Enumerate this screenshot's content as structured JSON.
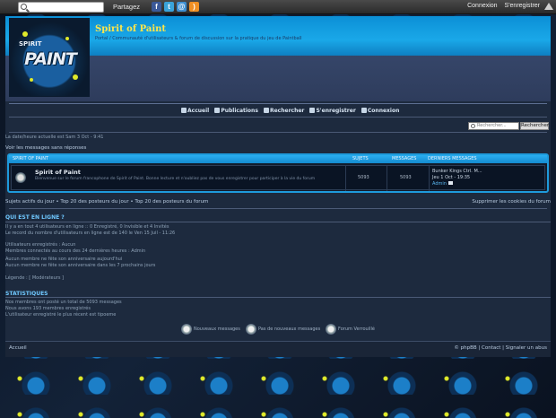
{
  "topbar": {
    "partagez": "Partagez",
    "connexion": "Connexion",
    "register": "S'enregistrer"
  },
  "header": {
    "logo_text": "PAINT",
    "logo_small": "SPIRIT",
    "title": "Spirit of Paint",
    "description": "Portal / Communauté d'utilisateurs & forum de discussion sur la pratique du jeu de Paintball"
  },
  "nav": {
    "items": [
      "Accueil",
      "Publications",
      "Rechercher",
      "S'enregistrer",
      "Connexion"
    ]
  },
  "search": {
    "placeholder": "Rechercher...",
    "button": "Rechercher"
  },
  "date_line": "La date/heure actuelle est Sam 3 Oct - 9:41",
  "unanswered_link": "Voir les messages sans réponses",
  "forum": {
    "category": "SPIRIT OF PAINT",
    "col_topics": "SUJETS",
    "col_posts": "MESSAGES",
    "col_last": "DERNIERS MESSAGES",
    "name": "Spirit of Paint",
    "description": "Bienvenue sur le forum francophone de Spirit of Paint. Bonne lecture et n'oubliez pas de vous enregistrer pour participer à la vie du forum",
    "topics": "5093",
    "posts": "5093",
    "last_title": "Bunker Kings Ctrl. M...",
    "last_date": "Jeu 1 Oct - 19:35",
    "last_author": "Admin"
  },
  "bottom_links": {
    "left": "Sujets actifs du jour • Top 20 des posteurs du jour • Top 20 des posteurs du forum",
    "right": "Supprimer les cookies du forum"
  },
  "online": {
    "title": "QUI EST EN LIGNE ?",
    "line1": "Il y a en tout 4 utilisateurs en ligne :: 0 Enregistré, 0 Invisible et 4 Invités",
    "line2": "Le record du nombre d'utilisateurs en ligne est de 140 le Ven 15 Juil - 11:26",
    "line3": "Utilisateurs enregistrés : Aucun",
    "line4": "Membres connectés au cours des 24 dernières heures : Admin",
    "line5": "Aucun membre ne fête son anniversaire aujourd'hui",
    "line6": "Aucun membre ne fête son anniversaire dans les 7 prochains jours",
    "legend": "Légende : [ Modérateurs ]"
  },
  "stats": {
    "title": "STATISTIQUES",
    "line1": "Nos membres ont posté un total de 5093 messages",
    "line2": "Nous avons 193 membres enregistrés",
    "line3": "L'utilisateur enregistré le plus récent est tipoeme"
  },
  "legend_icons": {
    "new": "Nouveaux messages",
    "none": "Pas de nouveaux messages",
    "locked": "Forum Verrouillé"
  },
  "footer": {
    "left": "Accueil",
    "right": "© phpBB | Contact | Signaler un abus"
  },
  "colors": {
    "accent": "#1e9bdc",
    "title_yellow": "#ffe64a",
    "section_title": "#6fc8ff"
  }
}
